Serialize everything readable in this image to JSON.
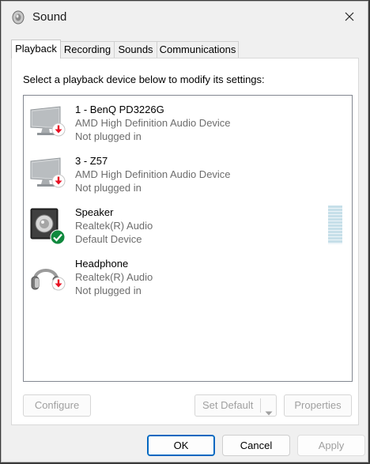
{
  "window": {
    "title": "Sound"
  },
  "tabs": [
    {
      "label": "Playback",
      "active": true
    },
    {
      "label": "Recording",
      "active": false
    },
    {
      "label": "Sounds",
      "active": false
    },
    {
      "label": "Communications",
      "active": false
    }
  ],
  "playback": {
    "instruction": "Select a playback device below to modify its settings:",
    "devices": [
      {
        "name": "1 - BenQ PD3226G",
        "driver": "AMD High Definition Audio Device",
        "status": "Not plugged in",
        "icon": "monitor-icon",
        "badge": "unplugged-badge"
      },
      {
        "name": "3 - Z57",
        "driver": "AMD High Definition Audio Device",
        "status": "Not plugged in",
        "icon": "monitor-icon",
        "badge": "unplugged-badge"
      },
      {
        "name": "Speaker",
        "driver": "Realtek(R) Audio",
        "status": "Default Device",
        "icon": "speaker-icon",
        "badge": "default-check-badge"
      },
      {
        "name": "Headphone",
        "driver": "Realtek(R) Audio",
        "status": "Not plugged in",
        "icon": "headphone-icon",
        "badge": "unplugged-badge"
      }
    ],
    "buttons": {
      "configure": "Configure",
      "set_default": "Set Default",
      "properties": "Properties"
    }
  },
  "footer": {
    "ok": "OK",
    "cancel": "Cancel",
    "apply": "Apply"
  },
  "colors": {
    "accent": "#0067c0",
    "unplugged": "#e81123",
    "default": "#10893e"
  }
}
